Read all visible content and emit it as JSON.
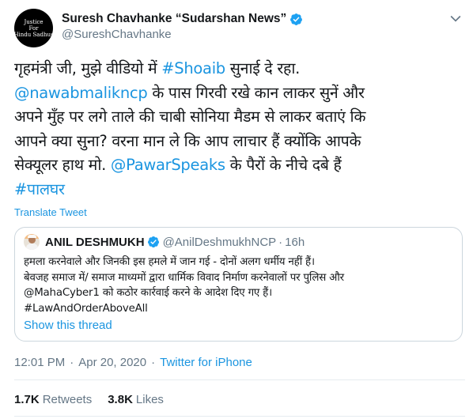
{
  "author": {
    "display_name": "Suresh Chavhanke “Sudarshan News”",
    "handle": "@SureshChavhanke",
    "avatar_lines": [
      "Justice",
      "For",
      "Hindu Sadhus"
    ]
  },
  "tweet": {
    "lines": [
      [
        {
          "text": "गृहमंत्री जी, मुझे वीडियो में ",
          "link": false
        },
        {
          "text": "#Shoaib",
          "link": true
        },
        {
          "text": " सुनाई दे रहा.",
          "link": false
        }
      ],
      [
        {
          "text": "@nawabmalikncp",
          "link": true
        },
        {
          "text": " के पास गिरवी रखे कान लाकर सुनें और",
          "link": false
        }
      ],
      [
        {
          "text": "अपने मुँह पर लगे ताले की चाबी सोनिया मैडम से लाकर बताएं कि",
          "link": false
        }
      ],
      [
        {
          "text": "आपने क्या सुना? वरना मान ले कि आप लाचार हैं क्योंकि आपके",
          "link": false
        }
      ],
      [
        {
          "text": "सेक्यूलर हाथ मो. ",
          "link": false
        },
        {
          "text": "@PawarSpeaks",
          "link": true
        },
        {
          "text": " के पैरों के नीचे दबे हैं",
          "link": false
        }
      ],
      [
        {
          "text": "#पालघर",
          "link": true
        }
      ]
    ],
    "translate_label": "Translate Tweet"
  },
  "quote": {
    "name": "ANIL DESHMUKH",
    "handle": "@AnilDeshmukhNCP",
    "dot": "·",
    "time": "16h",
    "lines": [
      "हमला करनेवाले और जिनकी इस हमले में जान गई -  दोनों अलग धर्मीय नहीं हैं।",
      "बेवजह समाज में/ समाज माध्यमों द्वारा धार्मिक विवाद  निर्माण करनेवालों पर पुलिस और",
      "@MahaCyber1 को कठोर कार्रवाई करने के आदेश दिए गए हैं।",
      "#LawAndOrderAboveAll"
    ],
    "show_thread": "Show this thread"
  },
  "meta": {
    "time": "12:01 PM",
    "sep": "·",
    "date": "Apr 20, 2020",
    "source": "Twitter for iPhone"
  },
  "stats": {
    "retweets_count": "1.7K",
    "retweets_label": "Retweets",
    "likes_count": "3.8K",
    "likes_label": "Likes"
  },
  "colors": {
    "link": "#1b95e0",
    "muted": "#657786",
    "text": "#14171a",
    "border": "#ccd6dd"
  }
}
